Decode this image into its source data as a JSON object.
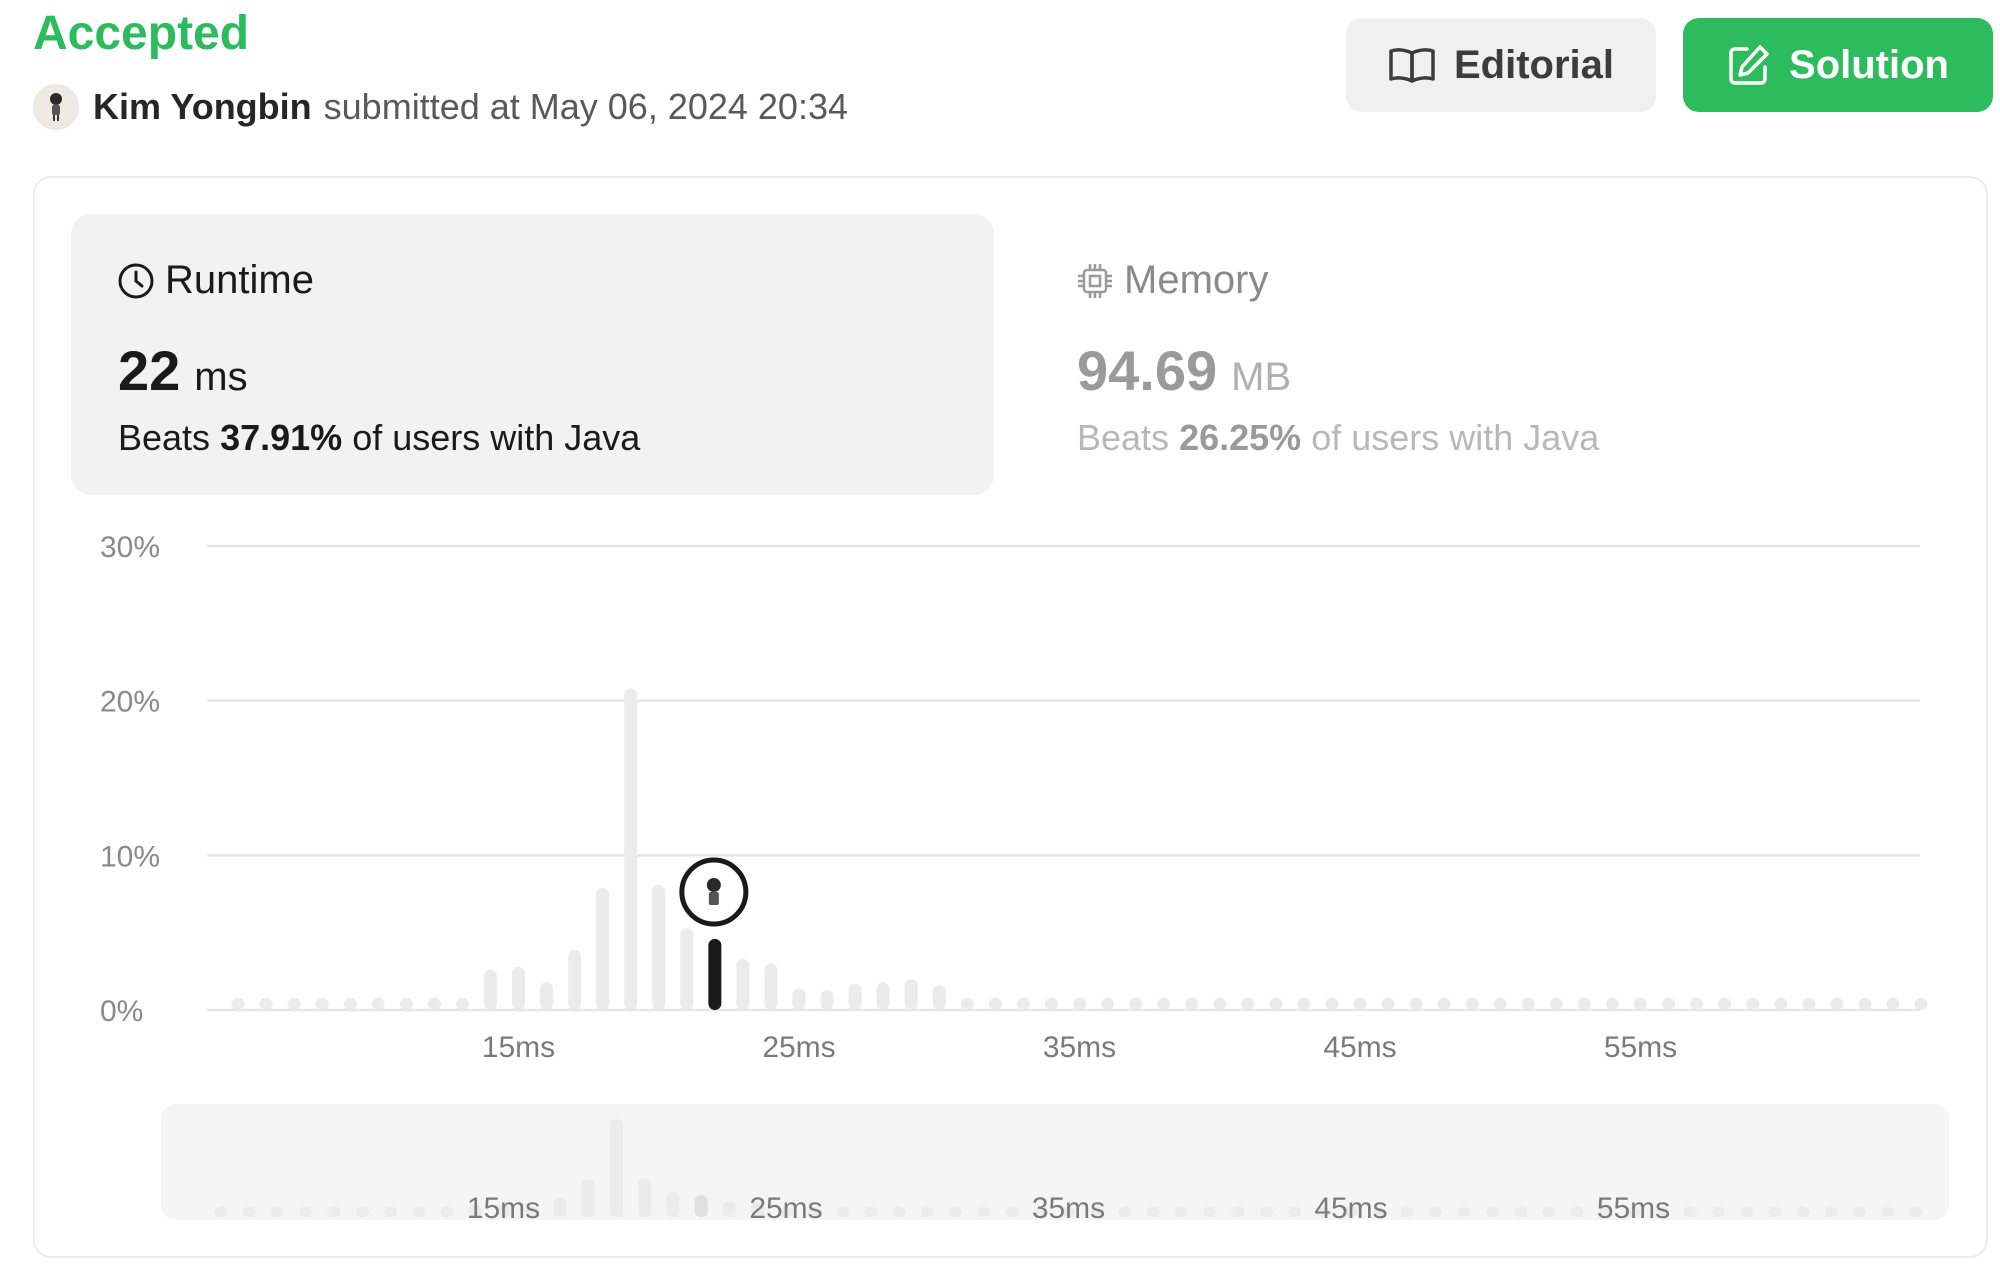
{
  "header": {
    "status": "Accepted",
    "user_name": "Kim Yongbin",
    "submitted_text": "submitted at May 06, 2024 20:34",
    "editorial_label": "Editorial",
    "solution_label": "Solution"
  },
  "runtime": {
    "title": "Runtime",
    "value": "22",
    "unit": "ms",
    "beats_prefix": "Beats",
    "beats_percent": "37.91%",
    "beats_suffix": "of users with Java"
  },
  "memory": {
    "title": "Memory",
    "value": "94.69",
    "unit": "MB",
    "beats_prefix": "Beats",
    "beats_percent": "26.25%",
    "beats_suffix": "of users with Java"
  },
  "colors": {
    "accent": "#2cbb5d",
    "bar_inactive": "#ebebeb",
    "bar_selected": "#1a1a1a",
    "grid": "#e6e6e6"
  },
  "chart_data": {
    "type": "bar",
    "y_tick_labels": [
      "0%",
      "10%",
      "20%",
      "30%"
    ],
    "ylim": [
      0,
      30
    ],
    "x_tick_labels": [
      "15ms",
      "25ms",
      "35ms",
      "45ms",
      "55ms"
    ],
    "x_ticks": [
      15,
      25,
      35,
      45,
      55
    ],
    "x": [
      5,
      6,
      7,
      8,
      9,
      10,
      11,
      12,
      13,
      14,
      15,
      16,
      17,
      18,
      19,
      20,
      21,
      22,
      23,
      24,
      25,
      26,
      27,
      28,
      29,
      30,
      31,
      32,
      33,
      34,
      35,
      36,
      37,
      38,
      39,
      40,
      41,
      42,
      43,
      44,
      45,
      46,
      47,
      48,
      49,
      50,
      51,
      52,
      53,
      54,
      55,
      56,
      57,
      58,
      59,
      60,
      61,
      62,
      63,
      64,
      65
    ],
    "values": [
      0.8,
      0.8,
      0.8,
      0.8,
      0.8,
      0.8,
      0.8,
      0.8,
      0.8,
      2.6,
      2.8,
      1.8,
      3.9,
      7.9,
      20.8,
      8.1,
      5.3,
      4.6,
      3.3,
      3.0,
      1.4,
      1.3,
      1.7,
      1.8,
      2.0,
      1.6,
      0.8,
      0.8,
      0.8,
      0.8,
      0.8,
      0.8,
      0.8,
      0.8,
      0.8,
      0.8,
      0.8,
      0.8,
      0.8,
      0.8,
      0.8,
      0.8,
      0.8,
      0.8,
      0.8,
      0.8,
      0.8,
      0.8,
      0.8,
      0.8,
      0.8,
      0.8,
      0.8,
      0.8,
      0.8,
      0.8,
      0.8,
      0.8,
      0.8,
      0.8,
      0.8
    ],
    "selected_x": 22,
    "grid": true
  }
}
